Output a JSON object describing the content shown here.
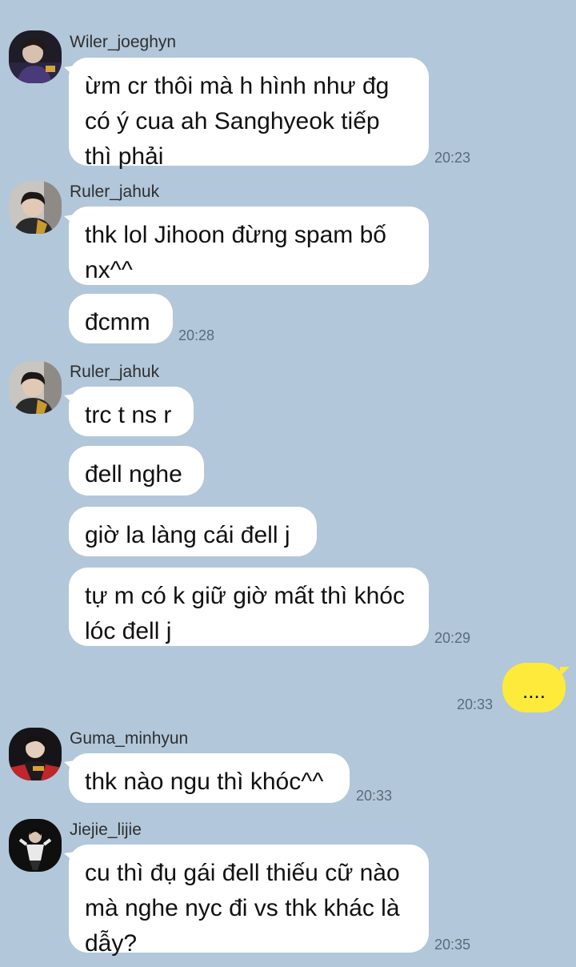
{
  "messages": {
    "m1": {
      "sender": "Wiler_joeghyn",
      "text": "ừm cr thôi mà h hình như đg có ý cua ah Sanghyeok tiếp thì phải",
      "time": "20:23"
    },
    "m2": {
      "sender": "Ruler_jahuk",
      "text": "thk lol Jihoon đừng spam bố nx^^"
    },
    "m3": {
      "text": "đcmm",
      "time": "20:28"
    },
    "m4": {
      "sender": "Ruler_jahuk",
      "text": "trc t ns r"
    },
    "m5": {
      "text": "đell nghe"
    },
    "m6": {
      "text": "giờ la làng cái đell j"
    },
    "m7": {
      "text": "tự m có k giữ giờ mất thì khóc lóc đell j",
      "time": "20:29"
    },
    "m8": {
      "text": "....",
      "time": "20:33"
    },
    "m9": {
      "sender": "Guma_minhyun",
      "text": "thk nào ngu thì khóc^^",
      "time": "20:33"
    },
    "m10": {
      "sender": "Jiejie_lijie",
      "text": "cu thì đụ gái đell thiếu cữ nào mà nghe nyc đi vs thk khác là dẫy?",
      "time": "20:35"
    }
  },
  "colors": {
    "background": "#b2c7da",
    "incoming_bubble": "#ffffff",
    "outgoing_bubble": "#fdea3b"
  },
  "icons": [
    "avatar-wiler",
    "avatar-ruler",
    "avatar-guma",
    "avatar-jiejie"
  ]
}
